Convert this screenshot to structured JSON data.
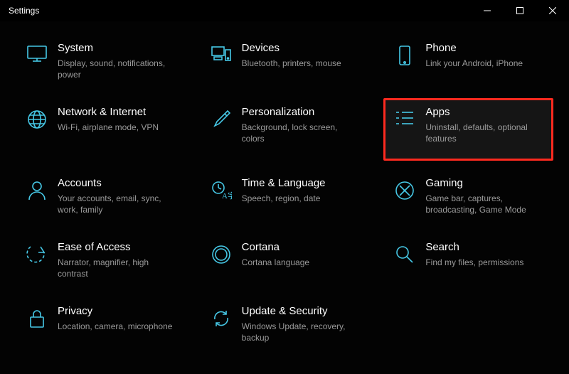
{
  "window": {
    "title": "Settings"
  },
  "accent": "#46c8e6",
  "highlighted_item": "apps",
  "items": {
    "system": {
      "title": "System",
      "desc": "Display, sound, notifications, power"
    },
    "devices": {
      "title": "Devices",
      "desc": "Bluetooth, printers, mouse"
    },
    "phone": {
      "title": "Phone",
      "desc": "Link your Android, iPhone"
    },
    "network": {
      "title": "Network & Internet",
      "desc": "Wi-Fi, airplane mode, VPN"
    },
    "personalization": {
      "title": "Personalization",
      "desc": "Background, lock screen, colors"
    },
    "apps": {
      "title": "Apps",
      "desc": "Uninstall, defaults, optional features"
    },
    "accounts": {
      "title": "Accounts",
      "desc": "Your accounts, email, sync, work, family"
    },
    "time": {
      "title": "Time & Language",
      "desc": "Speech, region, date"
    },
    "gaming": {
      "title": "Gaming",
      "desc": "Game bar, captures, broadcasting, Game Mode"
    },
    "ease": {
      "title": "Ease of Access",
      "desc": "Narrator, magnifier, high contrast"
    },
    "cortana": {
      "title": "Cortana",
      "desc": "Cortana language"
    },
    "search": {
      "title": "Search",
      "desc": "Find my files, permissions"
    },
    "privacy": {
      "title": "Privacy",
      "desc": "Location, camera, microphone"
    },
    "update": {
      "title": "Update & Security",
      "desc": "Windows Update, recovery, backup"
    }
  }
}
